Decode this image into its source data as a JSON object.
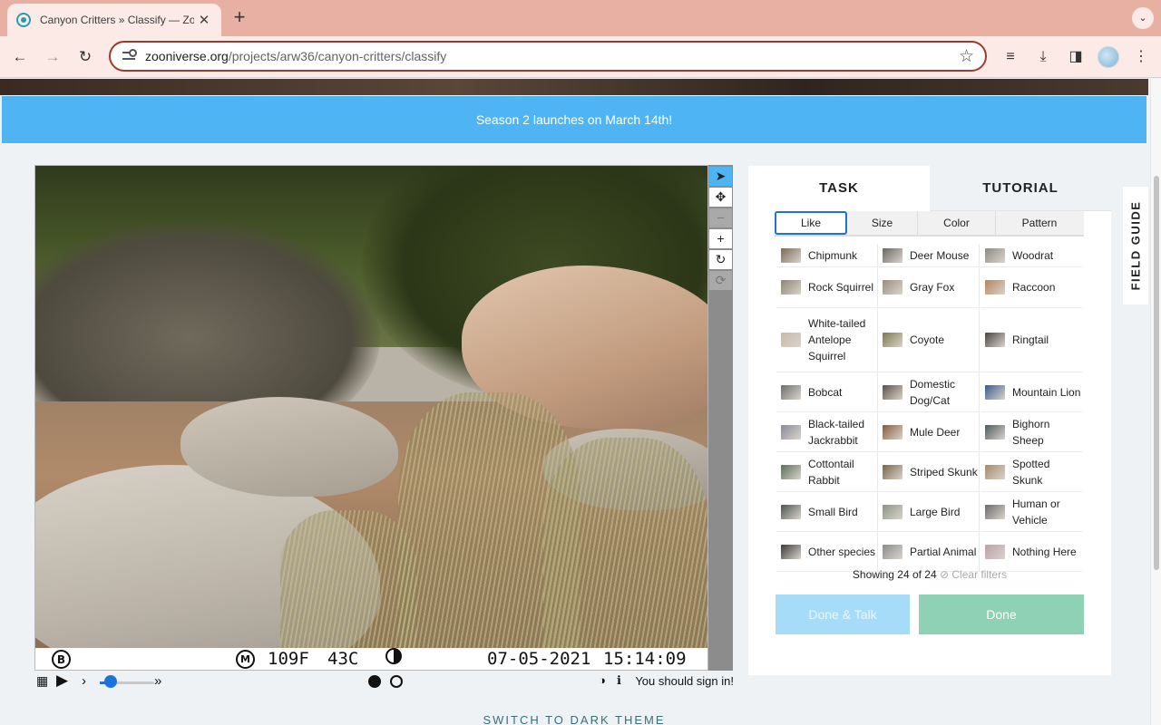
{
  "browser": {
    "tab_title": "Canyon Critters » Classify — Zooniverse",
    "url_host": "zooniverse.org",
    "url_path": "/projects/arw36/canyon-critters/classify"
  },
  "announcement": "Season 2 launches on March 14th!",
  "photo_stamp": {
    "camera_id": "B",
    "moon_mode": "M",
    "temp_f": "109F",
    "temp_c": "43C",
    "date": "07-05-2021",
    "time": "15:14:09"
  },
  "viewer": {
    "signin_text": "You should sign in!",
    "speed_level": 0.2,
    "frame_count": 2,
    "current_frame": 1
  },
  "task": {
    "tabs": [
      "TASK",
      "TUTORIAL"
    ],
    "active_tab": "TASK",
    "filters": [
      "Like",
      "Size",
      "Color",
      "Pattern"
    ],
    "active_filter": "Like",
    "species": [
      "Chipmunk",
      "Deer Mouse",
      "Woodrat",
      "Rock Squirrel",
      "Gray Fox",
      "Raccoon",
      "White-tailed Antelope Squirrel",
      "Coyote",
      "Ringtail",
      "Bobcat",
      "Domestic Dog/Cat",
      "Mountain Lion",
      "Black-tailed Jackrabbit",
      "Mule Deer",
      "Bighorn Sheep",
      "Cottontail Rabbit",
      "Striped Skunk",
      "Spotted Skunk",
      "Small Bird",
      "Large Bird",
      "Human or Vehicle",
      "Other species",
      "Partial Animal",
      "Nothing Here"
    ],
    "showing": "Showing 24 of 24",
    "clear_filters": "Clear filters",
    "done_talk": "Done & Talk",
    "done": "Done"
  },
  "field_guide": "FIELD GUIDE",
  "dark_theme": "SWITCH TO DARK THEME",
  "colors": {
    "announcement": "#4fb4f4",
    "done": "#8fd1b5",
    "done_talk": "#a6dcf7",
    "accent": "#1e73d8"
  }
}
